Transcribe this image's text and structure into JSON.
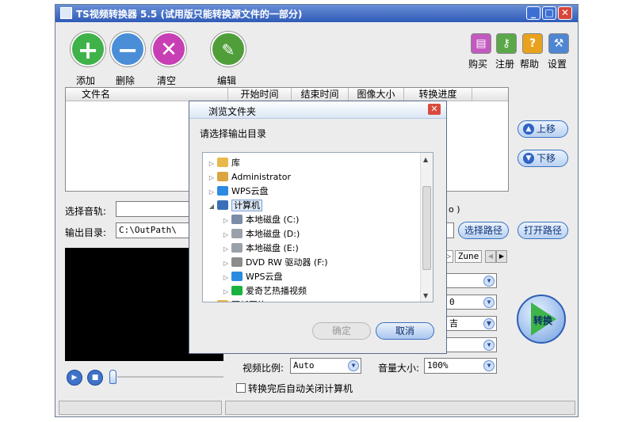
{
  "window": {
    "title": "TS视频转换器 5.5 (试用版只能转换源文件的一部分)",
    "min": "_",
    "max": "□",
    "close": "✕"
  },
  "toolbar": {
    "add": "添加",
    "delete": "删除",
    "clear": "清空",
    "edit": "编辑",
    "buy": "购买",
    "register": "注册",
    "help": "帮助",
    "settings": "设置"
  },
  "file_table": {
    "columns": [
      "文件名",
      "开始时间",
      "结束时间",
      "图像大小",
      "转换进度"
    ]
  },
  "side_buttons": {
    "up": "上移",
    "down": "下移"
  },
  "audio_track_label": "选择音轨:",
  "audio_track_tail": "o )",
  "output_dir_label": "输出目录:",
  "output_dir_value": "C:\\OutPath\\",
  "choose_path": "选择路径",
  "open_path": "打开路径",
  "format_tab": "Zune",
  "settings_fields": {
    "row2_tail": "0",
    "row3_tail": "吉",
    "aspect_label": "视频比例:",
    "aspect_value": "Auto",
    "volume_label": "音量大小:",
    "volume_value": "100%"
  },
  "convert_button": "转换",
  "shutdown_label": "转换完后自动关闭计算机",
  "dialog": {
    "title": "浏览文件夹",
    "close": "✕",
    "prompt": "请选择输出目录",
    "tree": [
      {
        "label": "库",
        "level": 0,
        "expander": "▷",
        "icon": "library-icon",
        "color": "#e8b84a"
      },
      {
        "label": "Administrator",
        "level": 0,
        "expander": "▷",
        "icon": "user-folder-icon",
        "color": "#d9a441"
      },
      {
        "label": "WPS云盘",
        "level": 0,
        "expander": "▷",
        "icon": "cloud-icon",
        "color": "#2b8be0"
      },
      {
        "label": "计算机",
        "level": 0,
        "expander": "◢",
        "icon": "computer-icon",
        "color": "#3a6fb7",
        "selected": true
      },
      {
        "label": "本地磁盘 (C:)",
        "level": 1,
        "expander": "▷",
        "icon": "system-drive-icon",
        "color": "#7b8da6"
      },
      {
        "label": "本地磁盘 (D:)",
        "level": 1,
        "expander": "▷",
        "icon": "drive-icon",
        "color": "#9aa1ab"
      },
      {
        "label": "本地磁盘 (E:)",
        "level": 1,
        "expander": "▷",
        "icon": "drive-icon",
        "color": "#9aa1ab"
      },
      {
        "label": "DVD RW 驱动器 (F:)",
        "level": 1,
        "expander": "▷",
        "icon": "dvd-drive-icon",
        "color": "#8c8c8c"
      },
      {
        "label": "WPS云盘",
        "level": 1,
        "expander": "▷",
        "icon": "cloud-icon",
        "color": "#2b8be0"
      },
      {
        "label": "爱奇艺热播视频",
        "level": 1,
        "expander": "▷",
        "icon": "iqiyi-icon",
        "color": "#18b23c"
      },
      {
        "label": "更新图片",
        "level": 0,
        "expander": "",
        "icon": "folder-icon",
        "color": "#e8b84a"
      }
    ],
    "ok": "确定",
    "cancel": "取消"
  },
  "colors": {
    "title_bar": "#2f5bb8",
    "add": "#3fb24a",
    "delete": "#4a8ed8",
    "clear": "#c83fb5",
    "convert": "#3db54a"
  }
}
